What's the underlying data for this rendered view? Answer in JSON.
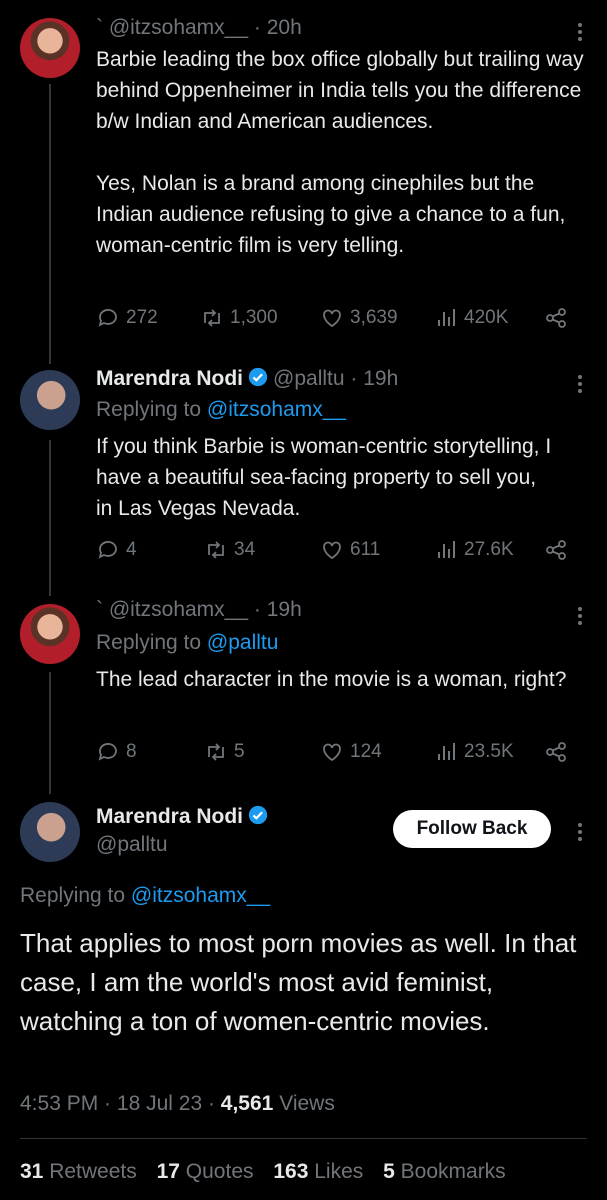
{
  "tweet1": {
    "handle": "` @itzsohamx__",
    "time": "· 20h",
    "text1": "Barbie leading the box office globally but trailing way behind Oppenheimer in India tells you the difference b/w Indian and American audiences.",
    "text2": "Yes, Nolan is a brand among cinephiles but the Indian audience refusing to give a chance to a fun, woman-centric film is very telling.",
    "replies": "272",
    "retweets": "1,300",
    "likes": "3,639",
    "views": "420K"
  },
  "tweet2": {
    "name": "Marendra Nodi",
    "handle": "@palltu",
    "time": "· 19h",
    "replying_label": "Replying to",
    "replying_to": "@itzsohamx__",
    "text": "If you think Barbie is woman-centric storytelling, I have a beautiful sea-facing property to sell you, in Las Vegas Nevada.",
    "replies": "4",
    "retweets": "34",
    "likes": "611",
    "views": "27.6K"
  },
  "tweet3": {
    "handle": "` @itzsohamx__",
    "time": "· 19h",
    "replying_label": "Replying to",
    "replying_to": "@palltu",
    "text": "The lead character in the movie is a woman, right?",
    "replies": "8",
    "retweets": "5",
    "likes": "124",
    "views": "23.5K"
  },
  "main": {
    "name": "Marendra Nodi",
    "handle": "@palltu",
    "follow_label": "Follow Back",
    "replying_label": "Replying to",
    "replying_to": "@itzsohamx__",
    "text": "That applies to most porn movies as well. In that case, I am the world's most avid feminist, watching a ton of women-centric movies.",
    "time": "4:53 PM",
    "date": "18 Jul 23",
    "views_count": "4,561",
    "views_label": "Views",
    "retweets_count": "31",
    "retweets_label": "Retweets",
    "quotes_count": "17",
    "quotes_label": "Quotes",
    "likes_count": "163",
    "likes_label": "Likes",
    "bookmarks_count": "5",
    "bookmarks_label": "Bookmarks"
  },
  "colors": {
    "background": "#000000",
    "text": "#e7e9ea",
    "muted": "#71767b",
    "link": "#1d9bf0"
  }
}
